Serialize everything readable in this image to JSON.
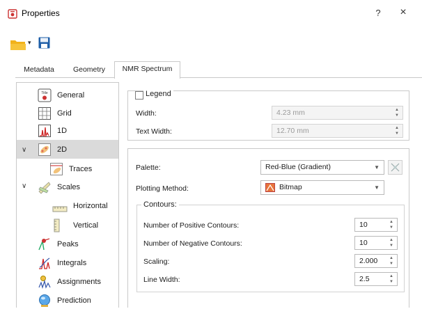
{
  "window": {
    "title": "Properties",
    "help_label": "?",
    "close_label": "×"
  },
  "toolbar": {
    "open_icon": "folder-open-icon",
    "save_icon": "save-disk-icon",
    "dropdown_label": "▾"
  },
  "tabs": [
    {
      "label": "Metadata",
      "active": false
    },
    {
      "label": "Geometry",
      "active": false
    },
    {
      "label": "NMR Spectrum",
      "active": true
    }
  ],
  "tree": {
    "items": [
      {
        "label": "General",
        "icon": "title-icon",
        "icon_text": "Title"
      },
      {
        "label": "Grid",
        "icon": "grid-icon"
      },
      {
        "label": "1D",
        "icon": "spectrum-1d-icon"
      },
      {
        "label": "2D",
        "icon": "spectrum-2d-icon",
        "selected": true,
        "expanded": true
      },
      {
        "label": "Traces",
        "icon": "traces-icon"
      },
      {
        "label": "Scales",
        "icon": "scales-icon",
        "expanded": true
      },
      {
        "label": "Horizontal",
        "icon": "horizontal-scale-icon"
      },
      {
        "label": "Vertical",
        "icon": "vertical-scale-icon"
      },
      {
        "label": "Peaks",
        "icon": "peaks-icon"
      },
      {
        "label": "Integrals",
        "icon": "integrals-icon"
      },
      {
        "label": "Assignments",
        "icon": "assignments-icon"
      },
      {
        "label": "Prediction",
        "icon": "prediction-icon"
      }
    ]
  },
  "legend": {
    "title": "Legend",
    "checked": false,
    "width_label": "Width:",
    "width_value": "4.23 mm",
    "text_width_label": "Text Width:",
    "text_width_value": "12.70 mm"
  },
  "palette": {
    "palette_label": "Palette:",
    "palette_value": "Red-Blue (Gradient)",
    "plotting_label": "Plotting Method:",
    "plotting_value": "Bitmap",
    "palette_edit_icon": "palette-edit-icon"
  },
  "contours": {
    "title": "Contours:",
    "fields": [
      {
        "label": "Number of Positive Contours:",
        "value": "10"
      },
      {
        "label": "Number of Negative Contours:",
        "value": "10"
      },
      {
        "label": "Scaling:",
        "value": "2.000"
      },
      {
        "label": "Line Width:",
        "value": "2.5"
      }
    ]
  },
  "colors": {
    "selected_row": "#dadada",
    "border": "#c9c9c9",
    "folder": "#f2b21b",
    "save": "#1f5fa8"
  }
}
